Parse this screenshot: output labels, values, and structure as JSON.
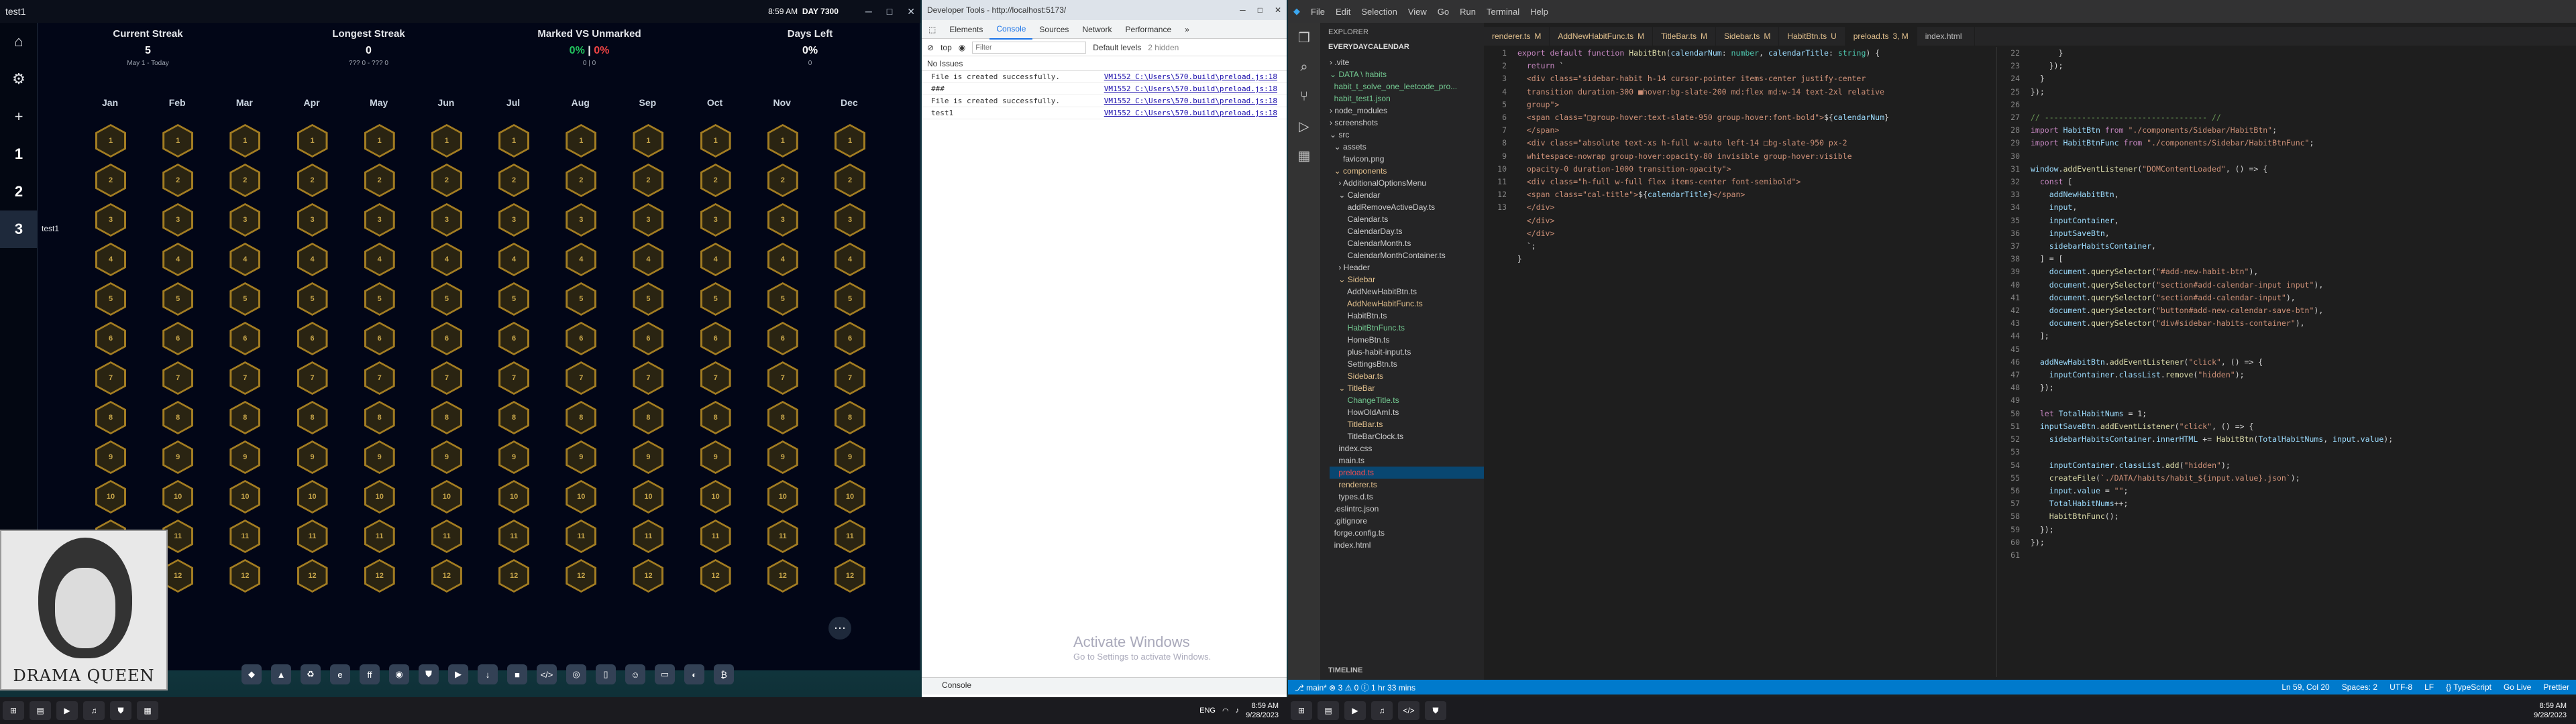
{
  "app": {
    "title": "test1",
    "clock": "8:59 AM",
    "day": "DAY 7300"
  },
  "sidebar": {
    "items": [
      "1",
      "2",
      "3"
    ],
    "active_label": "test1"
  },
  "stats": [
    {
      "label": "Current Streak",
      "value": "5",
      "sub": "May 1 - Today"
    },
    {
      "label": "Longest Streak",
      "value": "0",
      "sub": "??? 0 - ??? 0"
    },
    {
      "label": "Marked VS Unmarked",
      "value_marked": "0%",
      "value_sep": "|",
      "value_unmarked": "0%",
      "sub": "0 | 0"
    },
    {
      "label": "Days Left",
      "value": "0%",
      "sub": "0"
    }
  ],
  "months": [
    "Jan",
    "Feb",
    "Mar",
    "Apr",
    "May",
    "Jun",
    "Jul",
    "Aug",
    "Sep",
    "Oct",
    "Nov",
    "Dec"
  ],
  "days_per_month": [
    12,
    12,
    12,
    12,
    12,
    12,
    12,
    12,
    12,
    12,
    12,
    12
  ],
  "dq_text": "DRAMA QUEEN",
  "devtools": {
    "title": "Developer Tools - http://localhost:5173/",
    "tabs": [
      "Elements",
      "Console",
      "Sources",
      "Network",
      "Performance"
    ],
    "context": "top",
    "filter_placeholder": "Filter",
    "levels": "Default levels",
    "hidden": "2 hidden",
    "issues": "No Issues",
    "logs": [
      {
        "msg": "File is created successfully.",
        "src": "VM1552 C:\\Users\\570.build\\preload.js:18"
      },
      {
        "msg": "###",
        "src": "VM1552 C:\\Users\\570.build\\preload.js:18"
      },
      {
        "msg": "File is created successfully.",
        "src": "VM1552 C:\\Users\\570.build\\preload.js:18"
      },
      {
        "msg": "test1",
        "src": "VM1552 C:\\Users\\570.build\\preload.js:18"
      }
    ],
    "activate_title": "Activate Windows",
    "activate_sub": "Go to Settings to activate Windows.",
    "bottom_tab": "Console"
  },
  "vscode": {
    "menu": [
      "File",
      "Edit",
      "Selection",
      "View",
      "Go",
      "Run",
      "Terminal",
      "Help"
    ],
    "tabs": [
      {
        "label": "renderer.ts",
        "state": "M"
      },
      {
        "label": "AddNewHabitFunc.ts",
        "state": "M"
      },
      {
        "label": "TitleBar.ts",
        "state": "M"
      },
      {
        "label": "Sidebar.ts",
        "state": "M"
      },
      {
        "label": "HabitBtn.ts",
        "state": "U"
      },
      {
        "label": "preload.ts",
        "state": "3, M"
      },
      {
        "label": "index.html",
        "state": ""
      }
    ],
    "explorer_title": "EXPLORER",
    "project": "EVERYDAYCALENDAR",
    "tree": [
      {
        "n": "› .vite",
        "c": ""
      },
      {
        "n": "⌄ DATA \\ habits",
        "c": "new"
      },
      {
        "n": "  habit_t_solve_one_leetcode_pro...",
        "c": "new"
      },
      {
        "n": "  habit_test1.json",
        "c": "new"
      },
      {
        "n": "› node_modules",
        "c": ""
      },
      {
        "n": "› screenshots",
        "c": ""
      },
      {
        "n": "⌄ src",
        "c": ""
      },
      {
        "n": "  ⌄ assets",
        "c": ""
      },
      {
        "n": "      favicon.png",
        "c": ""
      },
      {
        "n": "  ⌄ components",
        "c": "mod"
      },
      {
        "n": "    › AdditionalOptionsMenu",
        "c": ""
      },
      {
        "n": "    ⌄ Calendar",
        "c": ""
      },
      {
        "n": "        addRemoveActiveDay.ts",
        "c": ""
      },
      {
        "n": "        Calendar.ts",
        "c": ""
      },
      {
        "n": "        CalendarDay.ts",
        "c": ""
      },
      {
        "n": "        CalendarMonth.ts",
        "c": ""
      },
      {
        "n": "        CalendarMonthContainer.ts",
        "c": ""
      },
      {
        "n": "    › Header",
        "c": ""
      },
      {
        "n": "    ⌄ Sidebar",
        "c": "mod"
      },
      {
        "n": "        AddNewHabitBtn.ts",
        "c": ""
      },
      {
        "n": "        AddNewHabitFunc.ts",
        "c": "mod"
      },
      {
        "n": "        HabitBtn.ts",
        "c": ""
      },
      {
        "n": "        HabitBtnFunc.ts",
        "c": "new"
      },
      {
        "n": "        HomeBtn.ts",
        "c": ""
      },
      {
        "n": "        plus-habit-input.ts",
        "c": ""
      },
      {
        "n": "        SettingsBtn.ts",
        "c": ""
      },
      {
        "n": "        Sidebar.ts",
        "c": "mod"
      },
      {
        "n": "    ⌄ TitleBar",
        "c": "mod"
      },
      {
        "n": "        ChangeTitle.ts",
        "c": "new"
      },
      {
        "n": "        HowOldAmI.ts",
        "c": ""
      },
      {
        "n": "        TitleBar.ts",
        "c": "mod"
      },
      {
        "n": "        TitleBarClock.ts",
        "c": ""
      },
      {
        "n": "    index.css",
        "c": ""
      },
      {
        "n": "    main.ts",
        "c": ""
      },
      {
        "n": "    preload.ts",
        "c": "err"
      },
      {
        "n": "    renderer.ts",
        "c": "mod"
      },
      {
        "n": "    types.d.ts",
        "c": ""
      },
      {
        "n": "  .eslintrc.json",
        "c": ""
      },
      {
        "n": "  .gitignore",
        "c": ""
      },
      {
        "n": "  forge.config.ts",
        "c": ""
      },
      {
        "n": "  index.html",
        "c": ""
      }
    ],
    "timeline": "TIMELINE",
    "status_left": "⎇ main*  ⊗ 3  ⚠ 0   ⓘ 1 hr 33 mins",
    "status_right": [
      "Ln 59, Col 20",
      "Spaces: 2",
      "UTF-8",
      "LF",
      "{} TypeScript",
      "Go Live",
      "Prettier"
    ]
  },
  "taskbar": {
    "time": "8:59 AM",
    "date": "9/28/2023",
    "lang": "ENG"
  }
}
